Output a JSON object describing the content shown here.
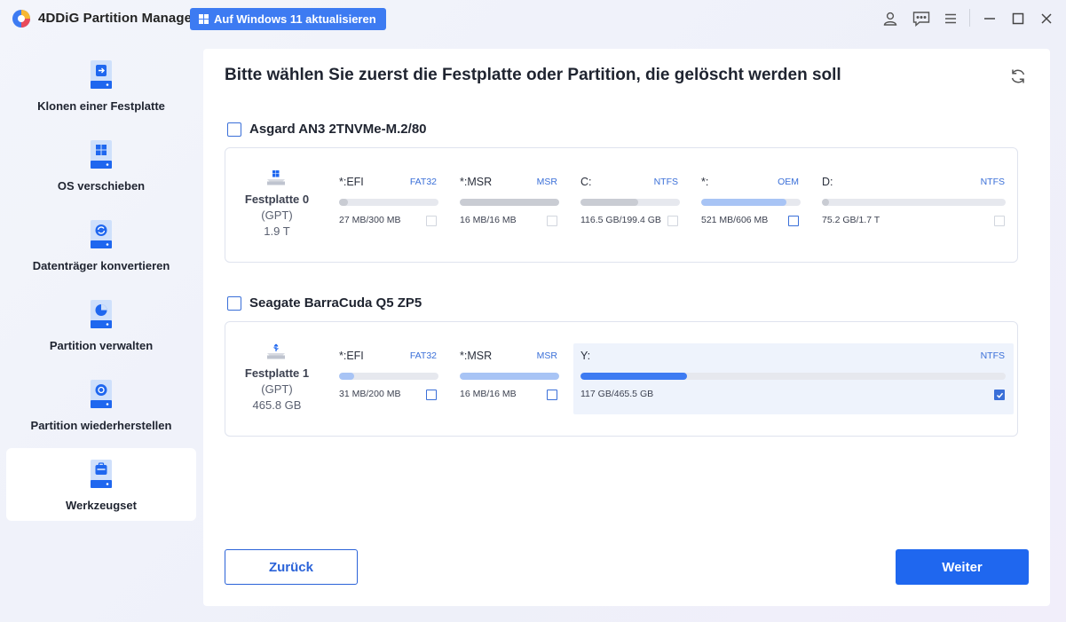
{
  "app": {
    "title": "4DDiG Partition Manager",
    "upgrade_label": "Auf Windows 11 aktualisieren"
  },
  "titlebar_icons": [
    "user-icon",
    "feedback-icon",
    "menu-icon",
    "minimize-icon",
    "maximize-icon",
    "close-icon"
  ],
  "sidebar": {
    "items": [
      {
        "label": "Klonen einer Festplatte",
        "icon": "clone-disk-icon"
      },
      {
        "label": "OS verschieben",
        "icon": "migrate-os-icon"
      },
      {
        "label": "Datenträger konvertieren",
        "icon": "convert-disk-icon"
      },
      {
        "label": "Partition verwalten",
        "icon": "manage-partition-icon"
      },
      {
        "label": "Partition wiederherstellen",
        "icon": "recover-partition-icon"
      },
      {
        "label": "Werkzeugset",
        "icon": "toolkit-icon"
      }
    ],
    "active_index": 5
  },
  "main": {
    "title": "Bitte wählen Sie zuerst die Festplatte oder Partition, die gelöscht werden soll",
    "disks": [
      {
        "name": "Asgard AN3 2TNVMe-M.2/80",
        "checked": false,
        "label": "Festplatte 0",
        "type": "(GPT)",
        "size": "1.9 T",
        "partitions": [
          {
            "name": "*:EFI",
            "fs": "FAT32",
            "usage": "27 MB/300 MB",
            "used_fraction": 0.09,
            "checkbox": "disabled"
          },
          {
            "name": "*:MSR",
            "fs": "MSR",
            "usage": "16 MB/16 MB",
            "used_fraction": 1.0,
            "checkbox": "disabled"
          },
          {
            "name": "C:",
            "fs": "NTFS",
            "usage": "116.5 GB/199.4 GB",
            "used_fraction": 0.58,
            "checkbox": "disabled"
          },
          {
            "name": "*:",
            "fs": "OEM",
            "usage": "521 MB/606 MB",
            "used_fraction": 0.86,
            "checkbox": "unchecked"
          },
          {
            "name": "D:",
            "fs": "NTFS",
            "usage": "75.2 GB/1.7 T",
            "used_fraction": 0.04,
            "checkbox": "disabled"
          }
        ]
      },
      {
        "name": "Seagate BarraCuda Q5 ZP5",
        "checked": false,
        "label": "Festplatte 1",
        "type": "(GPT)",
        "size": "465.8 GB",
        "partitions": [
          {
            "name": "*:EFI",
            "fs": "FAT32",
            "usage": "31 MB/200 MB",
            "used_fraction": 0.155,
            "checkbox": "unchecked"
          },
          {
            "name": "*:MSR",
            "fs": "MSR",
            "usage": "16 MB/16 MB",
            "used_fraction": 1.0,
            "checkbox": "unchecked"
          },
          {
            "name": "Y:",
            "fs": "NTFS",
            "usage": "117 GB/465.5 GB",
            "used_fraction": 0.25,
            "checkbox": "checked"
          }
        ]
      }
    ]
  },
  "buttons": {
    "back_label": "Zurück",
    "next_label": "Weiter"
  },
  "colors": {
    "accent": "#1f67ef",
    "bar_gray_fill": "#c9ccd3",
    "bar_light_blue_fill": "#a8c4f5",
    "bar_blue_fill": "#3d7bf2",
    "selected_bg": "#eef3fc"
  }
}
